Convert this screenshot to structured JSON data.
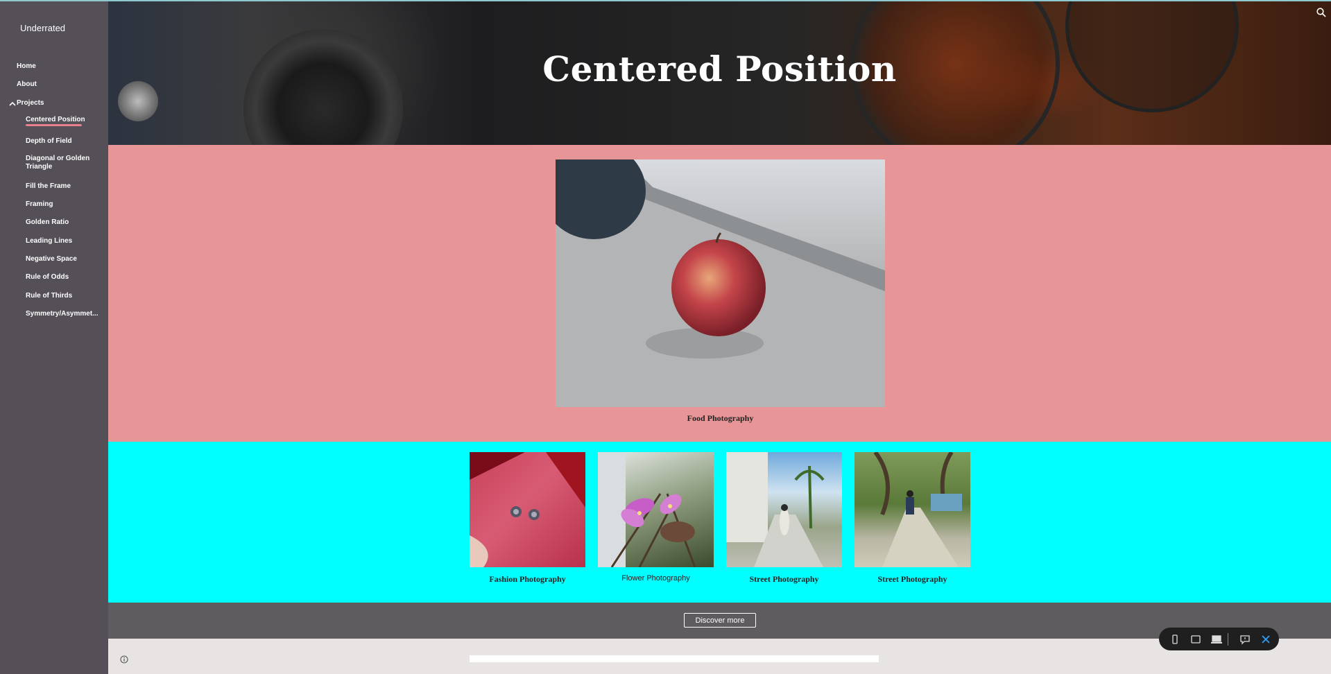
{
  "site": {
    "title": "Underrated"
  },
  "nav": {
    "home": "Home",
    "about": "About",
    "projects": "Projects",
    "sub_items": [
      "Centered Position",
      "Depth of Field",
      "Diagonal or Golden Triangle",
      "Fill the Frame",
      "Framing",
      "Golden Ratio",
      "Leading Lines",
      "Negative Space",
      "Rule of Odds",
      "Rule of Thirds",
      "Symmetry/Asymmet..."
    ]
  },
  "hero": {
    "title": "Centered Position"
  },
  "featured": {
    "caption": "Food Photography"
  },
  "gallery": [
    {
      "caption": "Fashion Photography"
    },
    {
      "caption": "Flower Photography"
    },
    {
      "caption": "Street Photography"
    },
    {
      "caption": "Street Photography"
    }
  ],
  "cta": {
    "label": "Discover more"
  },
  "colors": {
    "sidebar": "#554f57",
    "pink_section": "#e89598",
    "cyan_section": "#00ffff",
    "accent_underline": "#e8808c",
    "toolbar_close": "#29a3ff"
  },
  "icons": [
    "search-icon",
    "chevron-up-icon",
    "info-icon",
    "phone-icon",
    "tablet-icon",
    "laptop-icon",
    "comment-icon",
    "close-icon"
  ]
}
